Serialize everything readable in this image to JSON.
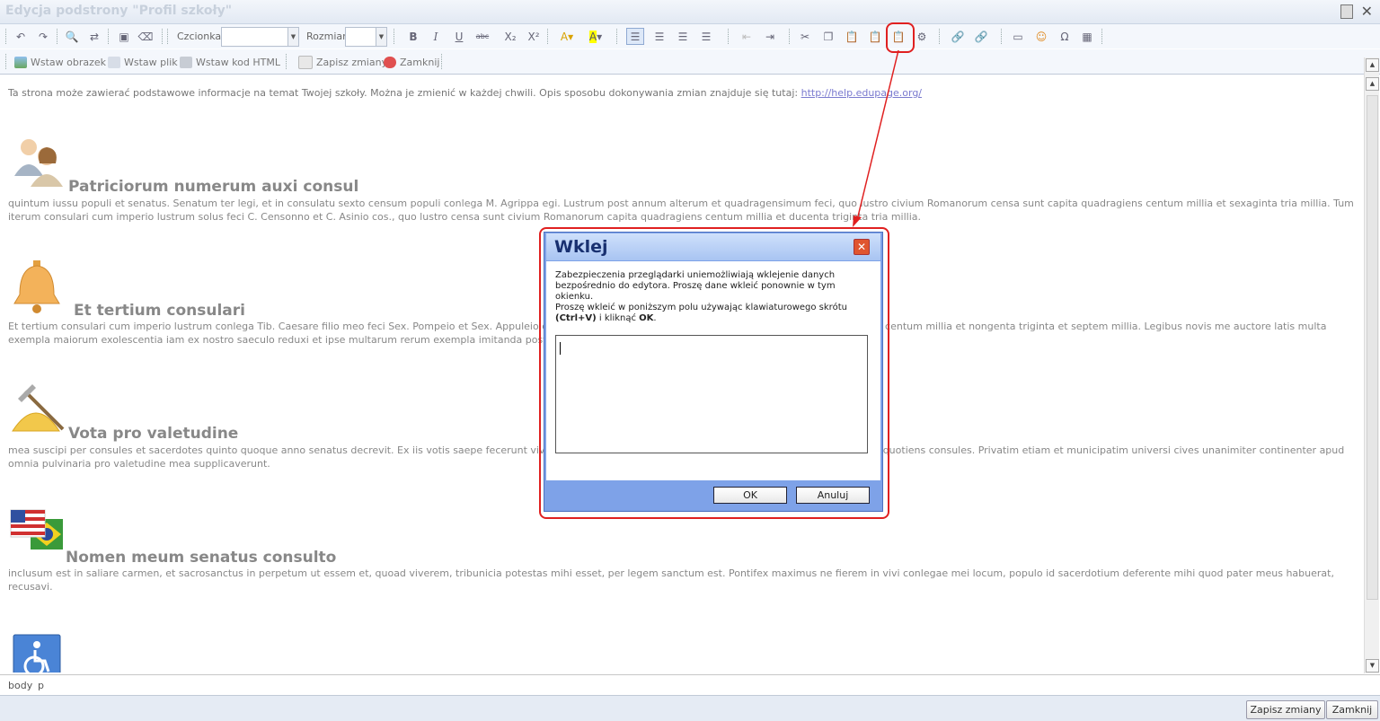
{
  "window": {
    "title": "Edycja podstrony \"Profil szkoły\""
  },
  "toolbar1": {
    "font_label": "Czcionka",
    "size_label": "Rozmiar"
  },
  "toolbar2": {
    "insert_image": "Wstaw obrazek",
    "insert_file": "Wstaw plik",
    "insert_html": "Wstaw kod HTML",
    "save_changes": "Zapisz zmiany",
    "close": "Zamknij"
  },
  "content": {
    "intro": "Ta strona może zawierać podstawowe informacje na temat Twojej szkoły. Można je zmienić w każdej chwili. Opis sposobu dokonywania zmian znajduje się tutaj: ",
    "intro_link": "http://help.edupage.org/",
    "sections": [
      {
        "title": "Patriciorum numerum auxi consul",
        "text": "quintum iussu populi et senatus. Senatum ter legi, et in consulatu sexto censum populi conlega M. Agrippa egi. Lustrum post annum alterum et quadragensimum feci, quo lustro civium Romanorum censa sunt capita quadragiens centum millia et sexaginta tria millia. Tum iterum consulari cum imperio lustrum solus feci C. Censonno et C. Asinio cos., quo lustro censa sunt civium Romanorum capita quadragiens centum millia et ducenta triginta tria millia."
      },
      {
        "title": "Et tertium consulari",
        "text": "Et tertium consulari cum imperio lustrum conlega Tib. Caesare filio meo feci Sex. Pompeio et Sex. Appuleio cos., quo lustro censa sunt civium Romanorum capitum quadragiens centum millia et nongenta triginta et septem millia. Legibus novis me auctore latis multa exempla maiorum exolescentia iam ex nostro saeculo reduxi et ipse multarum rerum exempla imitanda posteris tradidi."
      },
      {
        "title": "Vota pro valetudine",
        "text": "mea suscipi per consules et sacerdotes quinto quoque anno senatus decrevit. Ex iis votis saepe fecerunt vivo me ludos aliquotiens sacerdotum quattuor amplissima collegia, aliquotiens consules. Privatim etiam et municipatim universi cives unanimiter continenter apud omnia pulvinaria pro valetudine mea supplicaverunt."
      },
      {
        "title": "Nomen meum senatus consulto",
        "text": "inclusum est in saliare carmen, et sacrosanctus in perpetum ut essem et, quoad viverem, tribunicia potestas mihi esset, per legem sanctum est. Pontifex maximus ne fierem in vivi conlegae mei locum, populo id sacerdotium deferente mihi quod pater meus habuerat, recusavi."
      }
    ]
  },
  "status": {
    "path1": "body",
    "path2": "p"
  },
  "footer": {
    "save": "Zapisz zmiany",
    "close": "Zamknij"
  },
  "dialog": {
    "title": "Wklej",
    "message1": "Zabezpieczenia przeglądarki uniemożliwiają wklejenie danych bezpośrednio do edytora. Proszę dane wkleić ponownie w tym okienku.",
    "message2_pre": "Proszę wkleić w poniższym polu używając klawiaturowego skrótu ",
    "message2_shortcut": "(Ctrl+V)",
    "message2_mid": " i kliknąć ",
    "message2_ok": "OK",
    "message2_end": ".",
    "ok": "OK",
    "cancel": "Anuluj",
    "textarea_value": ""
  }
}
